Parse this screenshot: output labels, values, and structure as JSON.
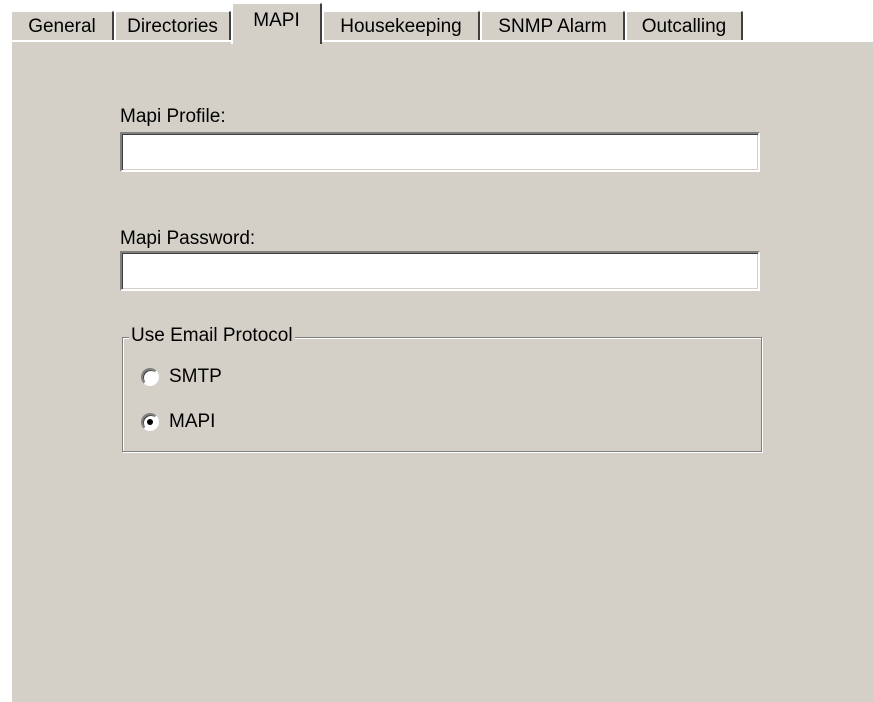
{
  "tabs": [
    {
      "label": "General",
      "active": false
    },
    {
      "label": "Directories",
      "active": false
    },
    {
      "label": "MAPI",
      "active": true
    },
    {
      "label": "Housekeeping",
      "active": false
    },
    {
      "label": "SNMP Alarm",
      "active": false
    },
    {
      "label": "Outcalling",
      "active": false
    }
  ],
  "form": {
    "profile_label": "Mapi Profile:",
    "profile_value": "",
    "password_label": "Mapi Password:",
    "password_value": ""
  },
  "protocol_group": {
    "title": "Use Email Protocol",
    "options": [
      {
        "label": "SMTP",
        "selected": false
      },
      {
        "label": "MAPI",
        "selected": true
      }
    ]
  },
  "colors": {
    "face": "#d4d0c8",
    "highlight": "#ffffff",
    "shadow": "#808080",
    "dark_shadow": "#404040"
  }
}
